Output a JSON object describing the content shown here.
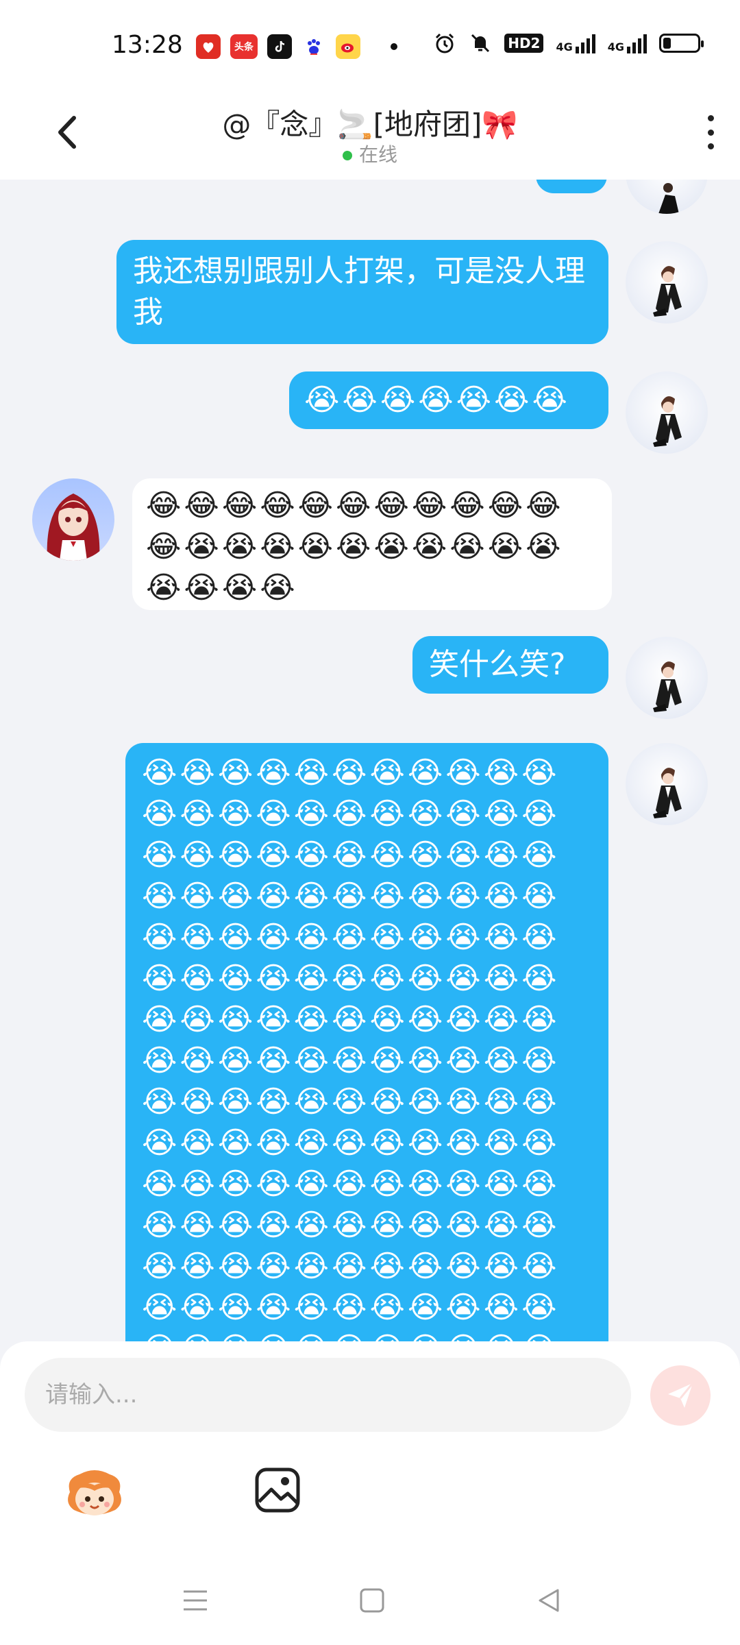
{
  "status_bar": {
    "time": "13:28",
    "app_icons": [
      "pinduoduo-icon",
      "toutiao-icon",
      "tiktok-icon",
      "baidu-icon",
      "weibo-icon"
    ],
    "toutiao_label": "头条",
    "network_hd": "HD2",
    "net1": "4G",
    "net2": "4G",
    "battery_level": 0.22
  },
  "header": {
    "title": "@『念』🚬[地府团]🎀",
    "status": "在线"
  },
  "messages": [
    {
      "from": "me",
      "text": "我还想别跟别人打架，可是没人理我"
    },
    {
      "from": "me",
      "text": "😭😭😭😭😭😭😭"
    },
    {
      "from": "her",
      "text": "😂😂😂😂😂😂😂😂😂😂😂😂😭😭😭😭😭😭😭😭😭😭😭😭😭😭"
    },
    {
      "from": "me",
      "text": "笑什么笑?"
    },
    {
      "from": "me",
      "text": "😭😭😭😭😭😭😭😭😭😭😭😭😭😭😭😭😭😭😭😭😭😭😭😭😭😭😭😭😭😭😭😭😭😭😭😭😭😭😭😭😭😭😭😭😭😭😭😭😭😭😭😭😭😭😭😭😭😭😭😭😭😭😭😭😭😭😭😭😭😭😭😭😭😭😭😭😭😭😭😭😭😭😭😭😭😭😭😭😭😭😭😭😭😭😭😭😭😭😭😭😭😭😭😭😭😭😭😭😭😭😭😭😭😭😭😭😭😭😭😭😭😭😭😭😭😭😭😭😭😭😭😭😭😭😭😭😭😭😭😭😭😭😭😭😭😭😭😭😭😭😭😭😭😭😭😭😭😭😭😭😭😭😭😭😭😭😭😭😭"
    }
  ],
  "input": {
    "placeholder": "请输入..."
  },
  "colors": {
    "out_bubble": "#29b4f6",
    "in_bubble": "#ffffff",
    "send_button": "#fde0de",
    "online_dot": "#2fbf4a"
  }
}
